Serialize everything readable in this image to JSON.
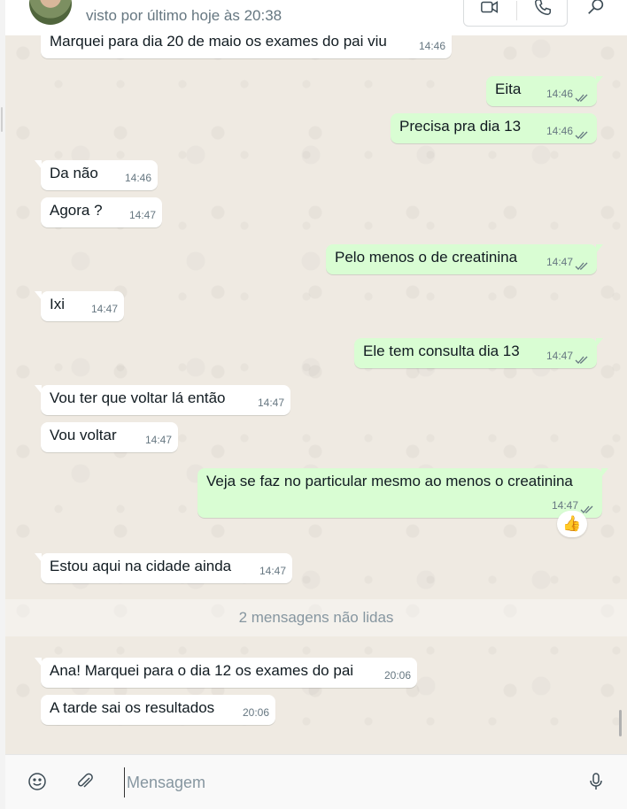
{
  "header": {
    "status": "visto por último hoje às 20:38",
    "icons": [
      "avatar",
      "video-call-icon",
      "voice-call-icon",
      "search-icon"
    ]
  },
  "messages": [
    {
      "dir": "in",
      "text": "Marquei para dia 20 de maio os exames do pai viu",
      "time": "14:46"
    },
    {
      "dir": "out",
      "text": "Eita",
      "time": "14:46"
    },
    {
      "dir": "out",
      "text": "Precisa pra dia 13",
      "time": "14:46"
    },
    {
      "dir": "in",
      "text": "Da não",
      "time": "14:46"
    },
    {
      "dir": "in",
      "text": "Agora ?",
      "time": "14:47"
    },
    {
      "dir": "out",
      "text": "Pelo menos o de creatinina",
      "time": "14:47"
    },
    {
      "dir": "in",
      "text": "Ixi",
      "time": "14:47"
    },
    {
      "dir": "out",
      "text": "Ele tem consulta dia 13",
      "time": "14:47"
    },
    {
      "dir": "in",
      "text": "Vou ter que voltar lá então",
      "time": "14:47"
    },
    {
      "dir": "in",
      "text": "Vou voltar",
      "time": "14:47"
    },
    {
      "dir": "out",
      "text": "Veja se faz no particular mesmo ao menos o creatinina",
      "time": "14:47",
      "reaction": "👍"
    },
    {
      "dir": "in",
      "text": "Estou aqui na cidade ainda",
      "time": "14:47"
    },
    {
      "dir": "in",
      "text": "Ana! Marquei para o dia 12 os exames do pai",
      "time": "20:06"
    },
    {
      "dir": "in",
      "text": "A tarde sai os resultados",
      "time": "20:06"
    }
  ],
  "unread_label": "2 mensagens não lidas",
  "composer": {
    "placeholder": "Mensagem",
    "icons": [
      "emoji-icon",
      "attach-icon",
      "mic-icon"
    ]
  },
  "colors": {
    "incoming_bubble": "#ffffff",
    "outgoing_bubble": "#d9fdd3",
    "chat_background": "#efeae2",
    "meta_text": "#667781",
    "read_tick": "#667781"
  }
}
